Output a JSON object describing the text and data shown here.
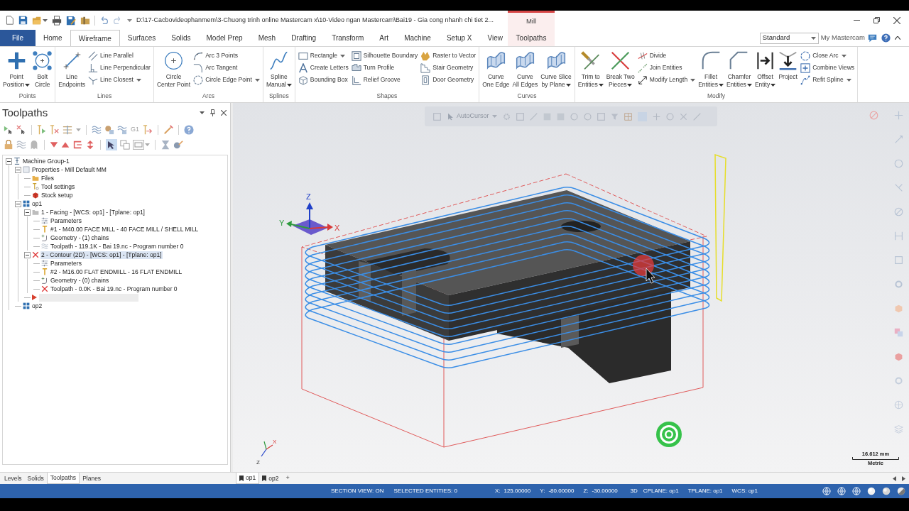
{
  "window": {
    "title": "D:\\17-Cacbovideophanmem\\3-Chuong trinh online Mastercam x\\10-Video ngan Mastercam\\Bai19 - Gia cong nhanh chi tiet 2...",
    "context_group": "Mill"
  },
  "ribbon_tabs": [
    {
      "label": "File",
      "kind": "file",
      "selected": false
    },
    {
      "label": "Home",
      "kind": "standard",
      "selected": false
    },
    {
      "label": "Wireframe",
      "kind": "standard",
      "selected": true
    },
    {
      "label": "Surfaces",
      "kind": "standard",
      "selected": false
    },
    {
      "label": "Solids",
      "kind": "standard",
      "selected": false
    },
    {
      "label": "Model Prep",
      "kind": "standard",
      "selected": false
    },
    {
      "label": "Mesh",
      "kind": "standard",
      "selected": false
    },
    {
      "label": "Drafting",
      "kind": "standard",
      "selected": false
    },
    {
      "label": "Transform",
      "kind": "standard",
      "selected": false
    },
    {
      "label": "Art",
      "kind": "standard",
      "selected": false
    },
    {
      "label": "Machine",
      "kind": "standard",
      "selected": false
    },
    {
      "label": "Setup X",
      "kind": "standard",
      "selected": false
    },
    {
      "label": "View",
      "kind": "standard",
      "selected": false
    },
    {
      "label": "Toolpaths",
      "kind": "contextual",
      "selected": false
    }
  ],
  "workspace_select": {
    "value": "Standard"
  },
  "account_link": "My Mastercam",
  "ribbon_groups": [
    {
      "label": "Points",
      "items": [
        {
          "kind": "large",
          "lines": [
            "Point",
            "Position"
          ],
          "dropdown": true
        },
        {
          "kind": "large",
          "lines": [
            "Bolt",
            "Circle"
          ],
          "dropdown": false
        }
      ]
    },
    {
      "label": "Lines",
      "items": [
        {
          "kind": "large",
          "lines": [
            "Line",
            "Endpoints"
          ],
          "dropdown": false
        },
        {
          "kind": "small",
          "label": "Line Parallel",
          "dropdown": false
        },
        {
          "kind": "small",
          "label": "Line Perpendicular",
          "dropdown": false
        },
        {
          "kind": "small",
          "label": "Line Closest",
          "dropdown": true
        }
      ]
    },
    {
      "label": "Arcs",
      "items": [
        {
          "kind": "large",
          "lines": [
            "Circle",
            "Center Point"
          ],
          "dropdown": false
        },
        {
          "kind": "small",
          "label": "Arc 3 Points",
          "dropdown": false
        },
        {
          "kind": "small",
          "label": "Arc Tangent",
          "dropdown": false
        },
        {
          "kind": "small",
          "label": "Circle Edge Point",
          "dropdown": true
        }
      ]
    },
    {
      "label": "Splines",
      "items": [
        {
          "kind": "large",
          "lines": [
            "Spline",
            "Manual"
          ],
          "dropdown": true
        }
      ]
    },
    {
      "label": "Shapes",
      "items": [
        {
          "kind": "small",
          "label": "Rectangle",
          "dropdown": true
        },
        {
          "kind": "small",
          "label": "Create Letters",
          "dropdown": false
        },
        {
          "kind": "small",
          "label": "Bounding Box",
          "dropdown": false
        },
        {
          "kind": "small",
          "label": "Silhouette Boundary",
          "dropdown": false
        },
        {
          "kind": "small",
          "label": "Turn Profile",
          "dropdown": false
        },
        {
          "kind": "small",
          "label": "Relief Groove",
          "dropdown": false
        },
        {
          "kind": "small",
          "label": "Raster to Vector",
          "dropdown": false
        },
        {
          "kind": "small",
          "label": "Stair Geometry",
          "dropdown": false
        },
        {
          "kind": "small",
          "label": "Door Geometry",
          "dropdown": false
        }
      ]
    },
    {
      "label": "Curves",
      "items": [
        {
          "kind": "large",
          "lines": [
            "Curve",
            "One Edge"
          ],
          "dropdown": false
        },
        {
          "kind": "large",
          "lines": [
            "Curve",
            "All Edges"
          ],
          "dropdown": false
        },
        {
          "kind": "large",
          "lines": [
            "Curve Slice",
            "by Plane"
          ],
          "dropdown": true
        }
      ]
    },
    {
      "label": "Modify",
      "items": [
        {
          "kind": "large",
          "lines": [
            "Trim to",
            "Entities"
          ],
          "dropdown": true
        },
        {
          "kind": "large",
          "lines": [
            "Break Two",
            "Pieces"
          ],
          "dropdown": true
        },
        {
          "kind": "small",
          "label": "Divide",
          "dropdown": false
        },
        {
          "kind": "small",
          "label": "Join Entities",
          "dropdown": false
        },
        {
          "kind": "small",
          "label": "Modify Length",
          "dropdown": true
        },
        {
          "kind": "large",
          "lines": [
            "Fillet",
            "Entities"
          ],
          "dropdown": true
        },
        {
          "kind": "large",
          "lines": [
            "Chamfer",
            "Entities"
          ],
          "dropdown": true
        },
        {
          "kind": "large",
          "lines": [
            "Offset",
            "Entity"
          ],
          "dropdown": true
        },
        {
          "kind": "large",
          "lines": [
            "Project"
          ],
          "dropdown": false
        },
        {
          "kind": "small",
          "label": "Close Arc",
          "dropdown": true
        },
        {
          "kind": "small",
          "label": "Combine Views",
          "dropdown": false
        },
        {
          "kind": "small",
          "label": "Refit Spline",
          "dropdown": true
        }
      ]
    }
  ],
  "toolpaths_panel": {
    "title": "Toolpaths",
    "toolbar_text": "G1",
    "tree": [
      {
        "kind": "machine-group",
        "label": "Machine Group-1",
        "selected": false,
        "expanded": true,
        "children": [
          {
            "kind": "properties",
            "label": "Properties - Mill Default MM",
            "selected": false,
            "expanded": true,
            "children": [
              {
                "kind": "files",
                "label": "Files",
                "selected": false
              },
              {
                "kind": "tool-settings",
                "label": "Tool settings",
                "selected": false
              },
              {
                "kind": "stock-setup",
                "label": "Stock setup",
                "selected": false
              }
            ]
          },
          {
            "kind": "toolgroup",
            "label": "op1",
            "selected": false,
            "expanded": true,
            "children": [
              {
                "kind": "operation",
                "label": "1 - Facing - [WCS: op1] - [Tplane: op1]",
                "selected": false,
                "dirty": false,
                "expanded": true,
                "children": [
                  {
                    "kind": "parameters",
                    "label": "Parameters",
                    "selected": false
                  },
                  {
                    "kind": "tool",
                    "label": "#1 - M40.00 FACE MILL - 40 FACE MILL / SHELL MILL",
                    "selected": false
                  },
                  {
                    "kind": "geometry",
                    "label": "Geometry - (1) chains",
                    "selected": false
                  },
                  {
                    "kind": "toolpath",
                    "label": "Toolpath - 119.1K - Bai 19.nc - Program number 0",
                    "selected": false,
                    "dirty": false
                  }
                ]
              },
              {
                "kind": "operation",
                "label": "2 - Contour (2D) - [WCS: op1] - [Tplane: op1]",
                "selected": true,
                "dirty": true,
                "expanded": true,
                "children": [
                  {
                    "kind": "parameters",
                    "label": "Parameters",
                    "selected": false
                  },
                  {
                    "kind": "tool",
                    "label": "#2 - M16.00 FLAT ENDMILL - 16 FLAT ENDMILL",
                    "selected": false
                  },
                  {
                    "kind": "geometry",
                    "label": "Geometry - (0) chains",
                    "selected": false
                  },
                  {
                    "kind": "toolpath",
                    "label": "Toolpath - 0.0K - Bai 19.nc - Program number 0",
                    "selected": false,
                    "dirty": true
                  }
                ]
              },
              {
                "kind": "insert-marker"
              }
            ]
          },
          {
            "kind": "toolgroup",
            "label": "op2",
            "selected": false
          }
        ]
      }
    ]
  },
  "viewport": {
    "autocursor_label": "AutoCursor",
    "gizmo_labels": [
      "Z",
      "Y",
      "X"
    ],
    "triad_labels": [
      "X",
      "Z"
    ],
    "scale_value": "16.612 mm",
    "scale_unit": "Metric"
  },
  "manager_tabs": [
    {
      "label": "Levels",
      "selected": false
    },
    {
      "label": "Solids",
      "selected": false
    },
    {
      "label": "Toolpaths",
      "selected": true
    },
    {
      "label": "Planes",
      "selected": false
    }
  ],
  "viewsheets": [
    {
      "label": "op1",
      "selected": true
    },
    {
      "label": "op2",
      "selected": false
    }
  ],
  "add_viewsheet": "+",
  "status_bar": {
    "section_view": "SECTION VIEW: ON",
    "selected_entities": "SELECTED ENTITIES: 0",
    "coordinates": [
      {
        "label": "X:",
        "value": "125.00000"
      },
      {
        "label": "Y:",
        "value": "-80.00000"
      },
      {
        "label": "Z:",
        "value": "-30.00000"
      }
    ],
    "mode": "3D",
    "cplane": "CPLANE: op1",
    "tplane": "TPLANE: op1",
    "wcs": "WCS: op1"
  }
}
